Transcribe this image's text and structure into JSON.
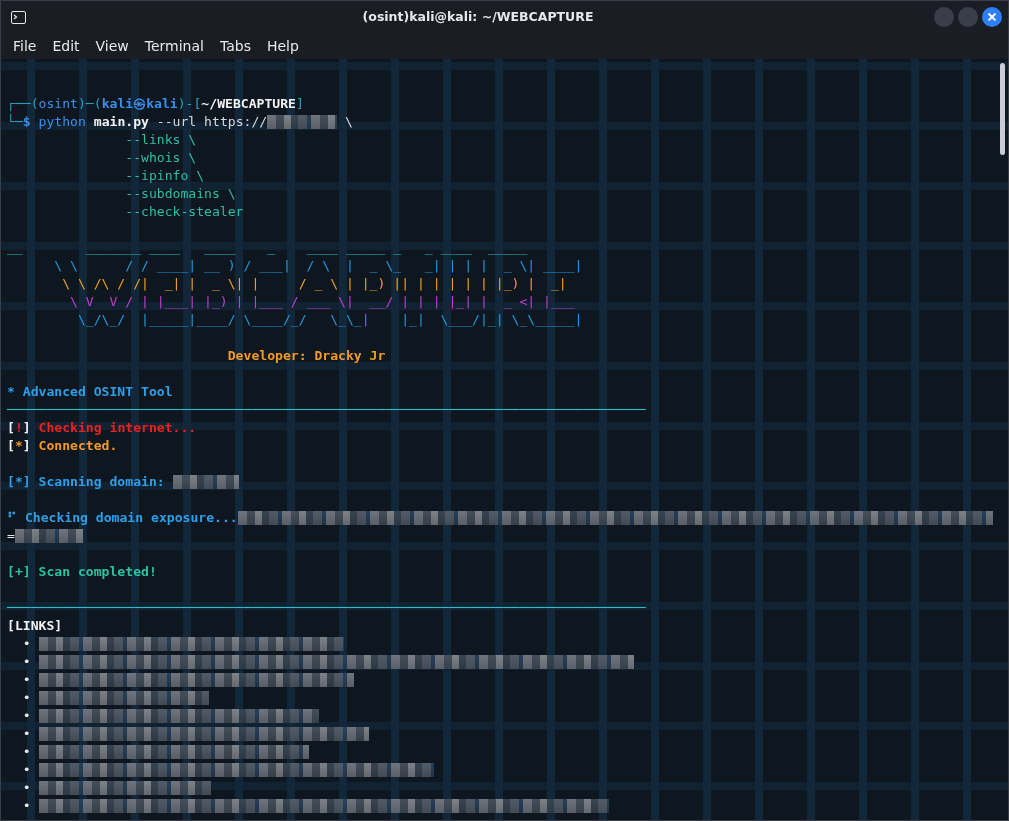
{
  "window": {
    "title": "(osint)kali@kali: ~/WEBCAPTURE"
  },
  "menu": [
    "File",
    "Edit",
    "View",
    "Terminal",
    "Tabs",
    "Help"
  ],
  "terminal": {
    "lines": [
      {
        "kind": "blank"
      },
      {
        "kind": "blank"
      },
      {
        "kind": "text",
        "segments": [
          {
            "kind": "frame",
            "text": "┌──("
          },
          {
            "kind": "venv",
            "text": "osint"
          },
          {
            "kind": "frame",
            "text": ")─("
          },
          {
            "kind": "user",
            "text": "kali㉿kali"
          },
          {
            "kind": "frame",
            "text": ")-["
          },
          {
            "kind": "dir",
            "text": "~/WEBCAPTURE"
          },
          {
            "kind": "frame",
            "text": "]"
          }
        ]
      },
      {
        "kind": "text",
        "segments": [
          {
            "kind": "frame",
            "text": "└─"
          },
          {
            "kind": "user",
            "text": "$ "
          },
          {
            "kind": "cmd",
            "text": "python "
          },
          {
            "kind": "file",
            "text": "main.py"
          },
          {
            "kind": "arg",
            "text": " --url https://"
          },
          {
            "kind": "redacted"
          },
          {
            "kind": "arg",
            "text": " \\"
          }
        ]
      },
      {
        "kind": "text",
        "segments": [
          {
            "kind": "flag",
            "text": "               --links \\"
          }
        ]
      },
      {
        "kind": "text",
        "segments": [
          {
            "kind": "flag",
            "text": "               --whois \\"
          }
        ]
      },
      {
        "kind": "text",
        "segments": [
          {
            "kind": "flag",
            "text": "               --ipinfo \\"
          }
        ]
      },
      {
        "kind": "text",
        "segments": [
          {
            "kind": "flag",
            "text": "               --subdomains \\"
          }
        ]
      },
      {
        "kind": "text",
        "segments": [
          {
            "kind": "flag",
            "text": "               --check-stealer"
          }
        ]
      },
      {
        "kind": "blank"
      },
      {
        "kind": "text",
        "segments": [
          {
            "kind": "banner-a",
            "text": "__        _______ ____   ____    _    ____ _____ _   _ ____  _____ "
          }
        ]
      },
      {
        "kind": "text",
        "segments": [
          {
            "kind": "banner-b",
            "text": "      \\ \\      / / ____| __ ) / ___|  / \\  |  _ \\_   _| | | |  _ \\| ____|"
          }
        ]
      },
      {
        "kind": "text",
        "segments": [
          {
            "kind": "banner-c",
            "text": "       \\ \\ /\\ / /|  _| |  _ \\| |     / _ \\ | |_) || | | | | | |_) |  _|  "
          }
        ]
      },
      {
        "kind": "text",
        "segments": [
          {
            "kind": "banner-d",
            "text": "        \\ V  V / | |___| |_) | |___ / ___ \\|  __/ | | | |_| |  _ <| |___ "
          }
        ]
      },
      {
        "kind": "text",
        "segments": [
          {
            "kind": "banner-b",
            "text": "         \\_/\\_/  |_____|____/ \\____/_/   \\_\\_|    |_|  \\___/|_| \\_\\_____|"
          }
        ]
      },
      {
        "kind": "blank"
      },
      {
        "kind": "text",
        "segments": [
          {
            "kind": "credit",
            "text": "                            Developer: Dracky Jr"
          }
        ]
      },
      {
        "kind": "blank"
      },
      {
        "kind": "text",
        "segments": [
          {
            "kind": "info",
            "text": "* Advanced OSINT Tool"
          }
        ]
      },
      {
        "kind": "text",
        "segments": [
          {
            "kind": "rule",
            "text": "─────────────────────────────────────────────────────────────────────────────────"
          }
        ]
      },
      {
        "kind": "text",
        "segments": [
          {
            "kind": "bracket",
            "text": "["
          },
          {
            "kind": "error",
            "text": "!"
          },
          {
            "kind": "bracket",
            "text": "]"
          },
          {
            "kind": "error",
            "text": " Checking internet..."
          }
        ]
      },
      {
        "kind": "text",
        "segments": [
          {
            "kind": "bracket",
            "text": "["
          },
          {
            "kind": "warn",
            "text": "*"
          },
          {
            "kind": "bracket",
            "text": "]"
          },
          {
            "kind": "warn",
            "text": " Connected."
          }
        ]
      },
      {
        "kind": "blank"
      },
      {
        "kind": "text",
        "segments": [
          {
            "kind": "info",
            "text": "[*] Scanning domain: "
          },
          {
            "kind": "redacted"
          }
        ]
      },
      {
        "kind": "blank"
      },
      {
        "kind": "text",
        "segments": [
          {
            "kind": "info",
            "text": "⠋ Checking domain exposure..."
          },
          {
            "kind": "redacted"
          }
        ]
      },
      {
        "kind": "text",
        "segments": [
          {
            "kind": "plain",
            "text": "="
          },
          {
            "kind": "redacted"
          }
        ]
      },
      {
        "kind": "blank"
      },
      {
        "kind": "text",
        "segments": [
          {
            "kind": "success",
            "text": "[+] Scan completed!"
          }
        ]
      },
      {
        "kind": "blank"
      },
      {
        "kind": "text",
        "segments": [
          {
            "kind": "rule",
            "text": "─────────────────────────────────────────────────────────────────────────────────"
          }
        ]
      },
      {
        "kind": "text",
        "segments": [
          {
            "kind": "section",
            "text": "[LINKS]"
          }
        ]
      },
      {
        "kind": "text",
        "segments": [
          {
            "kind": "bullet",
            "text": "  • "
          },
          {
            "kind": "redacted"
          }
        ]
      },
      {
        "kind": "text",
        "segments": [
          {
            "kind": "bullet",
            "text": "  • "
          },
          {
            "kind": "redacted"
          }
        ]
      },
      {
        "kind": "text",
        "segments": [
          {
            "kind": "bullet",
            "text": "  • "
          },
          {
            "kind": "redacted"
          }
        ]
      },
      {
        "kind": "text",
        "segments": [
          {
            "kind": "bullet",
            "text": "  • "
          },
          {
            "kind": "redacted"
          }
        ]
      },
      {
        "kind": "text",
        "segments": [
          {
            "kind": "bullet",
            "text": "  • "
          },
          {
            "kind": "redacted"
          }
        ]
      },
      {
        "kind": "text",
        "segments": [
          {
            "kind": "bullet",
            "text": "  • "
          },
          {
            "kind": "redacted"
          }
        ]
      },
      {
        "kind": "text",
        "segments": [
          {
            "kind": "bullet",
            "text": "  • "
          },
          {
            "kind": "redacted"
          }
        ]
      },
      {
        "kind": "text",
        "segments": [
          {
            "kind": "bullet",
            "text": "  • "
          },
          {
            "kind": "redacted"
          }
        ]
      },
      {
        "kind": "text",
        "segments": [
          {
            "kind": "bullet",
            "text": "  • "
          },
          {
            "kind": "redacted"
          }
        ]
      },
      {
        "kind": "text",
        "segments": [
          {
            "kind": "bullet",
            "text": "  • "
          },
          {
            "kind": "redacted"
          }
        ]
      }
    ]
  }
}
